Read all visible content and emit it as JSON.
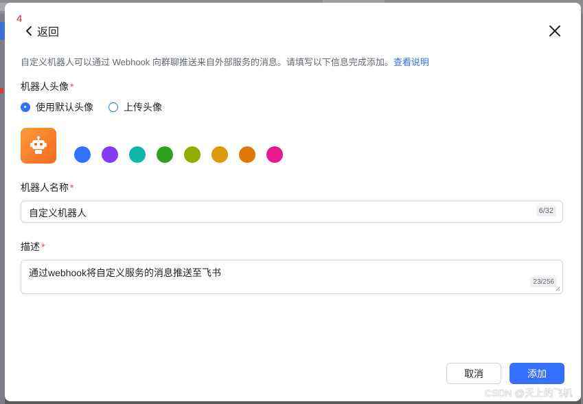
{
  "step_number": "4",
  "header": {
    "back_label": "返回"
  },
  "intro": {
    "text": "自定义机器人可以通过 Webhook 向群聊推送来自外部服务的消息。请填写以下信息完成添加。",
    "link": "查看说明"
  },
  "avatar_section": {
    "label": "机器人头像",
    "required_mark": "*",
    "options": [
      {
        "label": "使用默认头像",
        "checked": true
      },
      {
        "label": "上传头像",
        "checked": false
      }
    ],
    "avatar_icon": "robot-icon",
    "avatar_color": "#f5802e",
    "swatch_colors": [
      "#3370ff",
      "#7f3bf5",
      "#10b6a6",
      "#2ea121",
      "#8fac02",
      "#de9a0d",
      "#de7802",
      "#e8198b"
    ]
  },
  "name_field": {
    "label": "机器人名称",
    "required_mark": "*",
    "value": "自定义机器人",
    "counter": "6/32"
  },
  "desc_field": {
    "label": "描述",
    "required_mark": "*",
    "value": "通过webhook将自定义服务的消息推送至飞书",
    "counter": "23/256"
  },
  "footer": {
    "cancel_label": "取消",
    "add_label": "添加"
  },
  "colors": {
    "accent": "#3370ff",
    "required": "#f54a45",
    "step_number": "#e02e2e"
  },
  "watermark": "CSDN @天上的飞机"
}
